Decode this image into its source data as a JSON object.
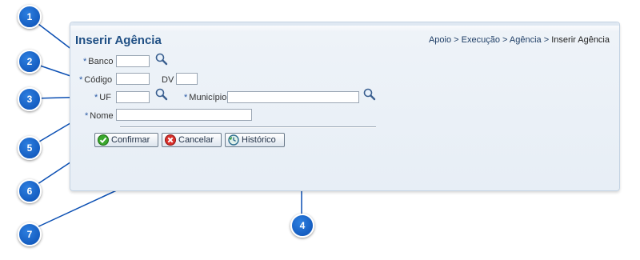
{
  "page": {
    "title": "Inserir Agência",
    "breadcrumb": {
      "items": [
        "Apoio",
        "Execução",
        "Agência"
      ],
      "separator": ">",
      "current": "Inserir Agência"
    }
  },
  "form": {
    "required_mark": "*",
    "banco_label": "Banco",
    "codigo_label": "Código",
    "dv_label": "DV",
    "uf_label": "UF",
    "municipio_label": "Município",
    "nome_label": "Nome",
    "banco_value": "",
    "codigo_value": "",
    "dv_value": "",
    "uf_value": "",
    "municipio_value": "",
    "nome_value": ""
  },
  "buttons": {
    "confirmar": "Confirmar",
    "cancelar": "Cancelar",
    "historico": "Histórico"
  },
  "callouts": [
    "1",
    "2",
    "3",
    "4",
    "5",
    "6",
    "7"
  ],
  "colors": {
    "callout": "#0b4fb3",
    "title": "#1f4f84",
    "panel_bg": "#e7eef6",
    "required": "#2a5aa5"
  }
}
